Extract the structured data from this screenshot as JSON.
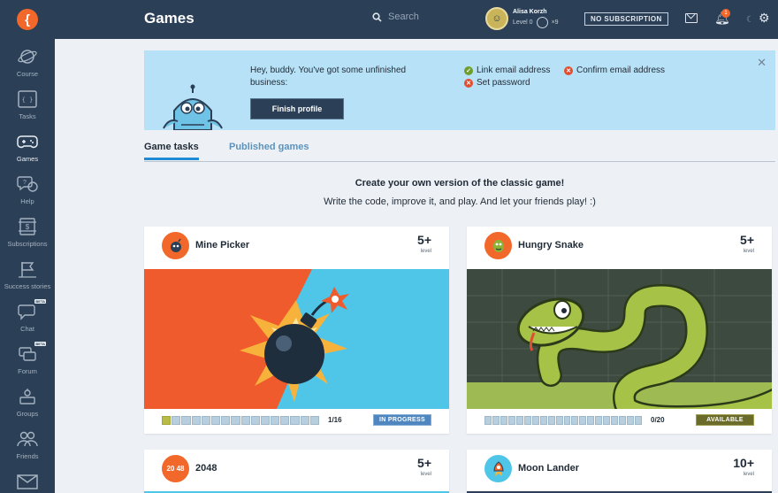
{
  "header": {
    "title": "Games",
    "search_placeholder": "Search",
    "user_name": "Alisa Korzh",
    "user_level": "Level 0",
    "user_xp": "×9",
    "subscription_label": "NO SUBSCRIPTION",
    "notification_count": "1"
  },
  "sidebar": {
    "items": [
      {
        "label": "Course",
        "icon": "planet-icon"
      },
      {
        "label": "Tasks",
        "icon": "code-icon"
      },
      {
        "label": "Games",
        "icon": "gamepad-icon"
      },
      {
        "label": "Help",
        "icon": "help-icon"
      },
      {
        "label": "Subscriptions",
        "icon": "subscription-icon"
      },
      {
        "label": "Success stories",
        "icon": "flag-icon"
      },
      {
        "label": "Chat",
        "icon": "chat-icon",
        "badge": "BETA"
      },
      {
        "label": "Forum",
        "icon": "forum-icon",
        "badge": "BETA"
      },
      {
        "label": "Groups",
        "icon": "groups-icon"
      },
      {
        "label": "Friends",
        "icon": "friends-icon"
      },
      {
        "label": "",
        "icon": "mail-icon"
      }
    ]
  },
  "banner": {
    "message": "Hey, buddy. You've got some unfinished business:",
    "button": "Finish profile",
    "tasks": [
      {
        "label": "Link email address",
        "done": true
      },
      {
        "label": "Confirm email address",
        "done": false
      },
      {
        "label": "Set password",
        "done": false
      }
    ]
  },
  "tabs": [
    {
      "label": "Game tasks",
      "active": true
    },
    {
      "label": "Published games",
      "active": false
    }
  ],
  "intro": {
    "title": "Create your own version of the classic game!",
    "subtitle": "Write the code, improve it, and play. And let your friends play! :)"
  },
  "games": [
    {
      "name": "Mine Picker",
      "level": "5+",
      "level_word": "level",
      "progress": "1/16",
      "done": 1,
      "total": 16,
      "status": "IN PROGRESS"
    },
    {
      "name": "Hungry Snake",
      "level": "5+",
      "level_word": "level",
      "progress": "0/20",
      "done": 0,
      "total": 20,
      "status": "AVAILABLE"
    },
    {
      "name": "2048",
      "level": "5+",
      "level_word": "level",
      "icon_text": "20 48"
    },
    {
      "name": "Moon Lander",
      "level": "10+",
      "level_word": "level"
    }
  ],
  "colors": {
    "header_bg": "#2b3f56",
    "accent_orange": "#f2682a",
    "banner_bg": "#b7e1f6",
    "tab_active": "#1f8bd4"
  }
}
